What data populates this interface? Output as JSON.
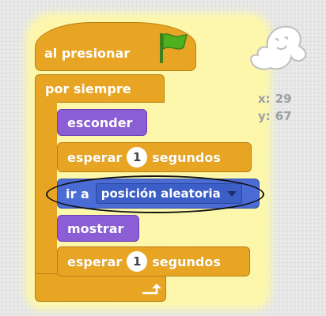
{
  "script": {
    "hat_label": "al presionar",
    "forever_label": "por siempre",
    "hide_label": "esconder",
    "wait1": {
      "pre": "esperar",
      "value": "1",
      "post": "segundos"
    },
    "goto": {
      "pre": "ir a",
      "option": "posición aleatoria"
    },
    "show_label": "mostrar",
    "wait2": {
      "pre": "esperar",
      "value": "1",
      "post": "segundos"
    }
  },
  "sprite_info": {
    "x_label": "x:",
    "x_value": "29",
    "y_label": "y:",
    "y_value": "67"
  },
  "icons": [
    "green-flag-icon",
    "loop-arrow-icon",
    "ghost-sprite-icon",
    "dropdown-caret-icon"
  ],
  "colors": {
    "control": "#e8a524",
    "looks": "#8c5ed6",
    "motion": "#4a6cd4",
    "highlight": "#fff9a6"
  }
}
